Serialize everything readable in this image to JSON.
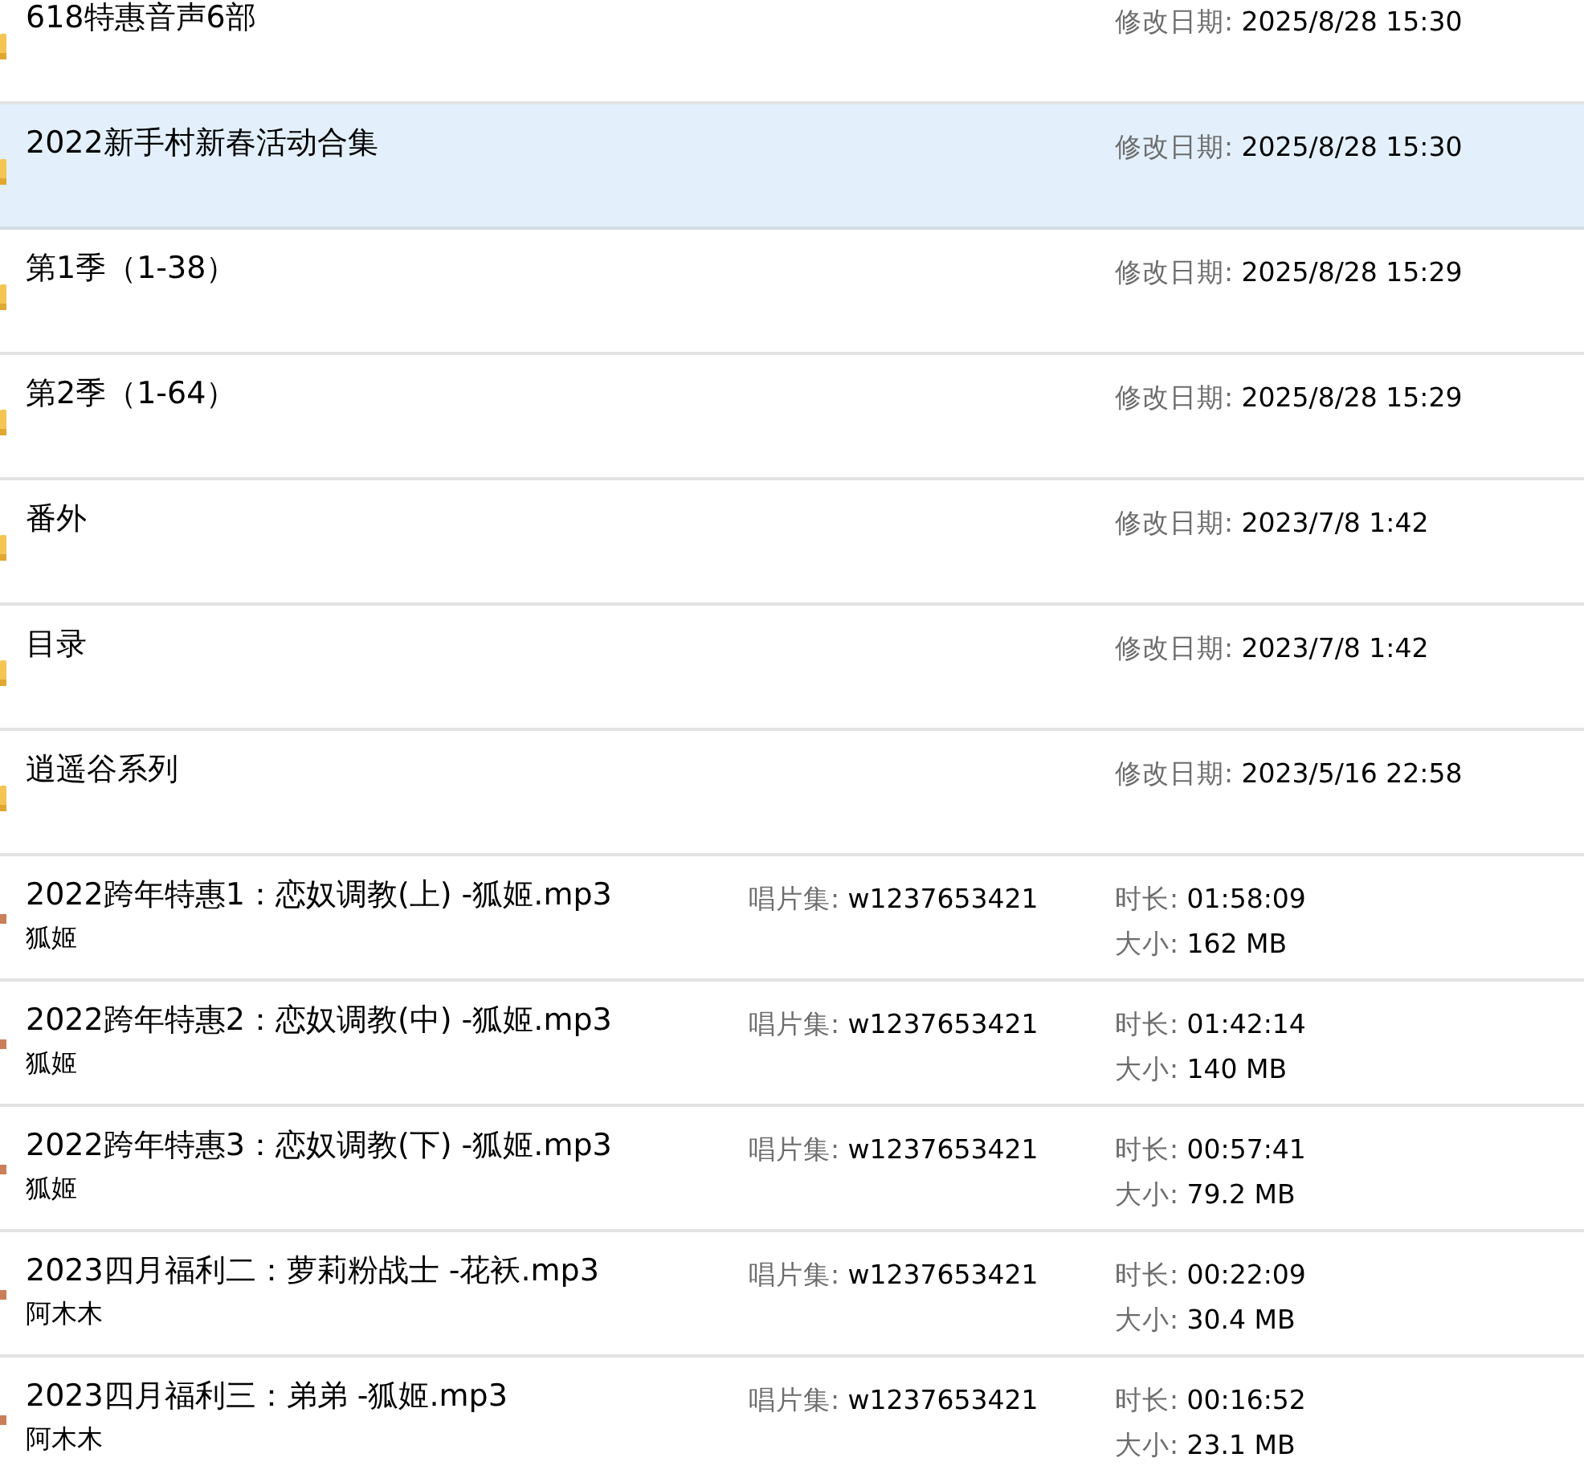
{
  "items": [
    {
      "kind": "folder",
      "name": "618特惠音声6部",
      "selected": false,
      "modified_label": "修改日期:",
      "modified": "2025/8/28 15:30"
    },
    {
      "kind": "folder",
      "name": "2022新手村新春活动合集",
      "selected": true,
      "modified_label": "修改日期:",
      "modified": "2025/8/28 15:30"
    },
    {
      "kind": "folder",
      "name": "第1季（1-38）",
      "selected": false,
      "modified_label": "修改日期:",
      "modified": "2025/8/28 15:29"
    },
    {
      "kind": "folder",
      "name": "第2季（1-64）",
      "selected": false,
      "modified_label": "修改日期:",
      "modified": "2025/8/28 15:29"
    },
    {
      "kind": "folder",
      "name": "番外",
      "selected": false,
      "modified_label": "修改日期:",
      "modified": "2023/7/8 1:42"
    },
    {
      "kind": "folder",
      "name": "目录",
      "selected": false,
      "modified_label": "修改日期:",
      "modified": "2023/7/8 1:42"
    },
    {
      "kind": "folder",
      "name": "逍遥谷系列",
      "selected": false,
      "modified_label": "修改日期:",
      "modified": "2023/5/16 22:58"
    },
    {
      "kind": "file",
      "name": "2022跨年特惠1：恋奴调教(上) -狐姬.mp3",
      "artist": "狐姬",
      "selected": false,
      "album_label": "唱片集:",
      "album": "w1237653421",
      "duration_label": "时长:",
      "duration": "01:58:09",
      "size_label": "大小:",
      "size": "162 MB"
    },
    {
      "kind": "file",
      "name": "2022跨年特惠2：恋奴调教(中) -狐姬.mp3",
      "artist": "狐姬",
      "selected": false,
      "album_label": "唱片集:",
      "album": "w1237653421",
      "duration_label": "时长:",
      "duration": "01:42:14",
      "size_label": "大小:",
      "size": "140 MB"
    },
    {
      "kind": "file",
      "name": "2022跨年特惠3：恋奴调教(下) -狐姬.mp3",
      "artist": "狐姬",
      "selected": false,
      "album_label": "唱片集:",
      "album": "w1237653421",
      "duration_label": "时长:",
      "duration": "00:57:41",
      "size_label": "大小:",
      "size": "79.2 MB"
    },
    {
      "kind": "file",
      "name": "2023四月福利二：萝莉粉战士  -花袄.mp3",
      "artist": "阿木木",
      "selected": false,
      "album_label": "唱片集:",
      "album": "w1237653421",
      "duration_label": "时长:",
      "duration": "00:22:09",
      "size_label": "大小:",
      "size": "30.4 MB"
    },
    {
      "kind": "file",
      "name": "2023四月福利三：弟弟  -狐姬.mp3",
      "artist": "阿木木",
      "selected": false,
      "album_label": "唱片集:",
      "album": "w1237653421",
      "duration_label": "时长:",
      "duration": "00:16:52",
      "size_label": "大小:",
      "size": "23.1 MB"
    }
  ]
}
